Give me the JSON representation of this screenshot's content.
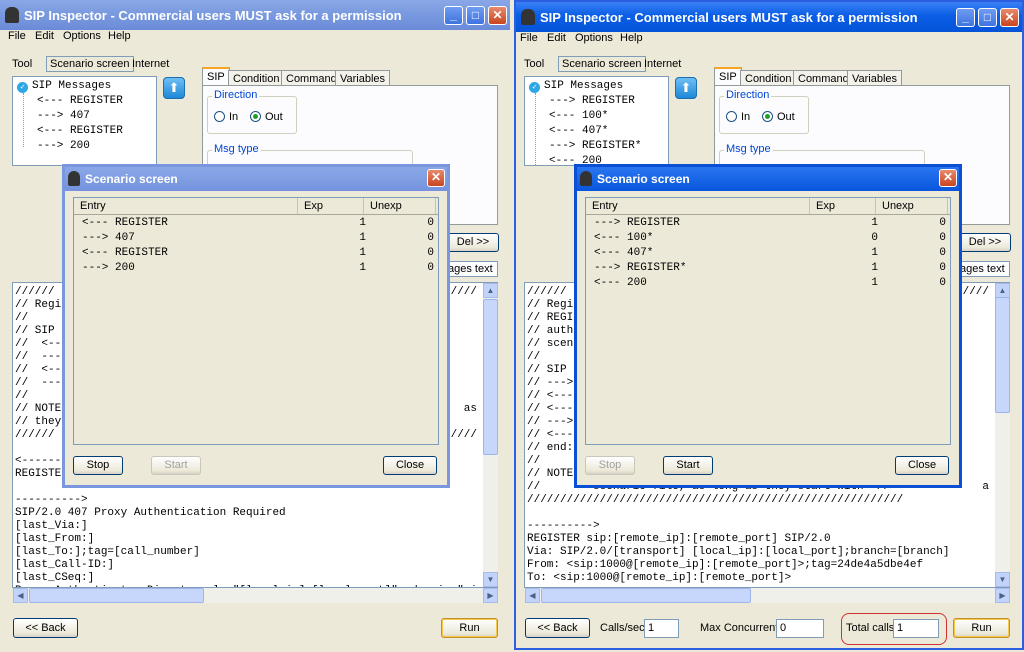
{
  "window_title": "SIP Inspector - Commercial users MUST ask for a permission",
  "menu": [
    "File",
    "Edit",
    "Options",
    "Help"
  ],
  "modes": {
    "tool": "Tool",
    "scenario": "Scenario screen",
    "internet": "Internet"
  },
  "tabs": [
    "SIP",
    "Condition",
    "Command",
    "Variables"
  ],
  "direction": {
    "title": "Direction",
    "in": "In",
    "out": "Out",
    "selected": "Out"
  },
  "msg_type": {
    "title": "Msg type"
  },
  "del_button": "Del >>",
  "messages_text_tab": "ages text",
  "back_button": "<< Back",
  "run_button": "Run",
  "left": {
    "tree_root": "SIP Messages",
    "tree_items": [
      "<--- REGISTER",
      "---> 407",
      "<--- REGISTER",
      "---> 200"
    ],
    "text_lines": [
      "//////",
      "// Regi",
      "//",
      "// SIP ",
      "//  <--",
      "//  ---",
      "//  <--",
      "//  ---",
      "//",
      "// NOTE",
      "// they",
      "//////",
      "",
      "<------",
      "REGISTER",
      "",
      "---------->",
      "SIP/2.0 407 Proxy Authentication Required",
      "[last_Via:]",
      "[last_From:]",
      "[last_To:];tag=[call_number]",
      "[last_Call-ID:]",
      "[last_CSeq:]",
      "Proxy-Authenticate: Digest realm=\"[local_ip]:[local_port]\", domain=\"sip:"
    ],
    "text_right_fragments": [
      "////",
      "as",
      "////"
    ],
    "dialog": {
      "title": "Scenario screen",
      "columns": [
        "Entry",
        "Exp",
        "Unexp"
      ],
      "rows": [
        {
          "entry": "<--- REGISTER",
          "exp": "1",
          "unexp": "0"
        },
        {
          "entry": "---> 407",
          "exp": "1",
          "unexp": "0"
        },
        {
          "entry": "<--- REGISTER",
          "exp": "1",
          "unexp": "0"
        },
        {
          "entry": "---> 200",
          "exp": "1",
          "unexp": "0"
        }
      ],
      "stop": "Stop",
      "start": "Start",
      "close": "Close"
    }
  },
  "right": {
    "tree_root": "SIP Messages",
    "tree_items": [
      "---> REGISTER",
      "<--- 100*",
      "<--- 407*",
      "---> REGISTER*",
      "<--- 200"
    ],
    "text_lines": [
      "//////",
      "// Regi",
      "// REGI",
      "// auth",
      "// scen",
      "//",
      "// SIP ",
      "// --->",
      "// <---",
      "// <---",
      "// --->",
      "// <---",
      "// end:",
      "//",
      "// NOTE",
      "//        scenario file, as long as they start with \"//\"",
      "/////////////////////////////////////////////////////////",
      "",
      "---------->",
      "REGISTER sip:[remote_ip]:[remote_port] SIP/2.0",
      "Via: SIP/2.0/[transport] [local_ip]:[local_port];branch=[branch]",
      "From: <sip:1000@[remote_ip]:[remote_port]>;tag=24de4a5dbe4ef",
      "To: <sip:1000@[remote_ip]:[remote_port]>"
    ],
    "text_right_fragments": [
      "////",
      "a"
    ],
    "dialog": {
      "title": "Scenario screen",
      "columns": [
        "Entry",
        "Exp",
        "Unexp"
      ],
      "rows": [
        {
          "entry": "---> REGISTER",
          "exp": "1",
          "unexp": "0"
        },
        {
          "entry": "<--- 100*",
          "exp": "0",
          "unexp": "0"
        },
        {
          "entry": "<--- 407*",
          "exp": "1",
          "unexp": "0"
        },
        {
          "entry": "---> REGISTER*",
          "exp": "1",
          "unexp": "0"
        },
        {
          "entry": "<--- 200",
          "exp": "1",
          "unexp": "0"
        }
      ],
      "stop": "Stop",
      "start": "Start",
      "close": "Close"
    },
    "calls_sec_label": "Calls/sec",
    "calls_sec_value": "1",
    "max_concurrent_label": "Max Concurrent",
    "max_concurrent_value": "0",
    "total_calls_label": "Total calls",
    "total_calls_value": "1"
  }
}
